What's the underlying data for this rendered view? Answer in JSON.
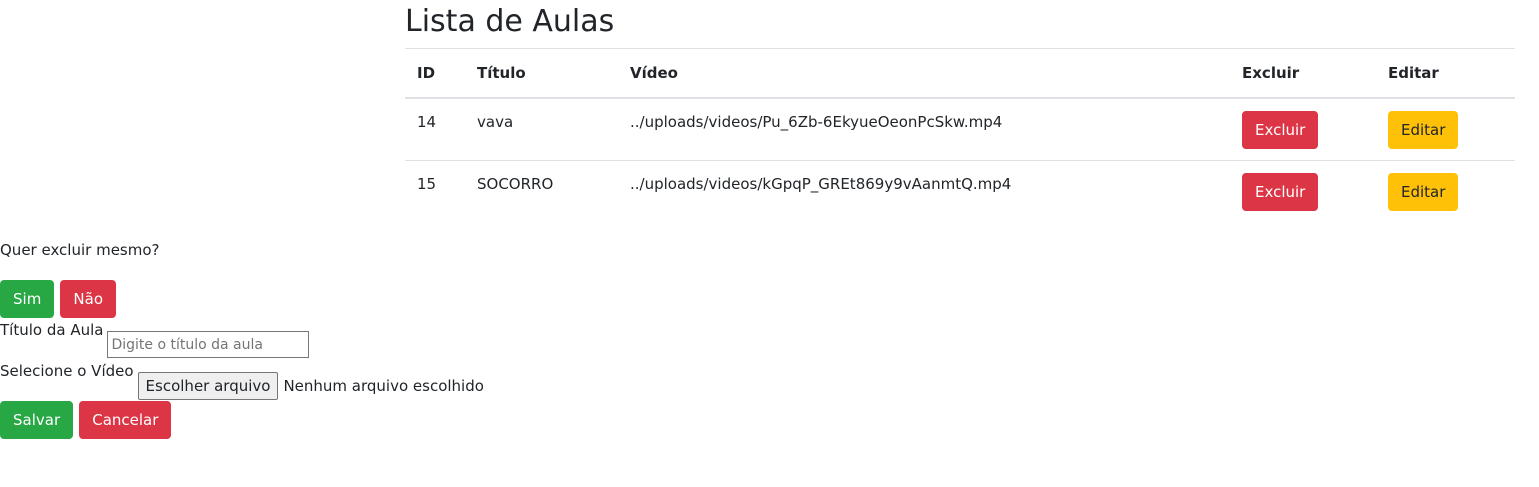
{
  "page": {
    "title": "Lista de Aulas"
  },
  "table": {
    "headers": [
      "ID",
      "Título",
      "Vídeo",
      "Excluir",
      "Editar"
    ],
    "rows": [
      {
        "id": "14",
        "titulo": "vava",
        "video": "../uploads/videos/Pu_6Zb-6EkyueOeonPcSkw.mp4",
        "excluir": "Excluir",
        "editar": "Editar"
      },
      {
        "id": "15",
        "titulo": "SOCORRO",
        "video": "../uploads/videos/kGpqP_GREt869y9vAanmtQ.mp4",
        "excluir": "Excluir",
        "editar": "Editar"
      }
    ]
  },
  "confirm": {
    "question": "Quer excluir mesmo?",
    "yes_label": "Sim",
    "no_label": "Não"
  },
  "form": {
    "title_label": "Título da Aula",
    "title_placeholder": "Digite o título da aula",
    "title_value": "",
    "video_label": "Selecione o Vídeo",
    "file_button_label": "Escolher arquivo",
    "file_status": "Nenhum arquivo escolhido",
    "save_label": "Salvar",
    "cancel_label": "Cancelar"
  },
  "colors": {
    "danger": "#dc3545",
    "warning": "#ffc107",
    "success": "#28a745"
  }
}
